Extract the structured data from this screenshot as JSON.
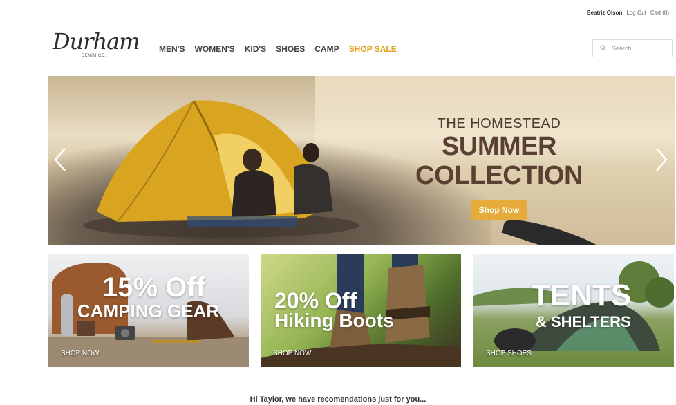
{
  "account": {
    "user_name": "Beatriz Olson",
    "logout_label": "Log Out",
    "cart_label": "Cart (0)"
  },
  "brand": {
    "logo_text": "Durham",
    "logo_subtext": "DENIM CO."
  },
  "nav": {
    "items": [
      "MEN'S",
      "WOMEN'S",
      "KID'S",
      "SHOES",
      "CAMP"
    ],
    "sale_label": "SHOP SALE",
    "sale_color": "#e3a21a"
  },
  "search": {
    "placeholder": "Search"
  },
  "hero": {
    "eyebrow": "THE HOMESTEAD",
    "headline": "SUMMER COLLECTION",
    "cta_label": "Shop Now",
    "cta_color": "#e5ac3b"
  },
  "promos": [
    {
      "line1": "15% Off",
      "line2": "CAMPING GEAR",
      "link": "SHOP NOW"
    },
    {
      "line1": "20% Off",
      "line2": "Hiking Boots",
      "link": "SHOP NOW"
    },
    {
      "line1": "TENTS",
      "line2": "& SHELTERS",
      "link": "SHOP SHOES"
    }
  ],
  "recommendations": {
    "message": "Hi Taylor, we have recomendations just for you..."
  },
  "icons": {
    "search": "search-icon",
    "prev": "chevron-left-icon",
    "next": "chevron-right-icon"
  }
}
